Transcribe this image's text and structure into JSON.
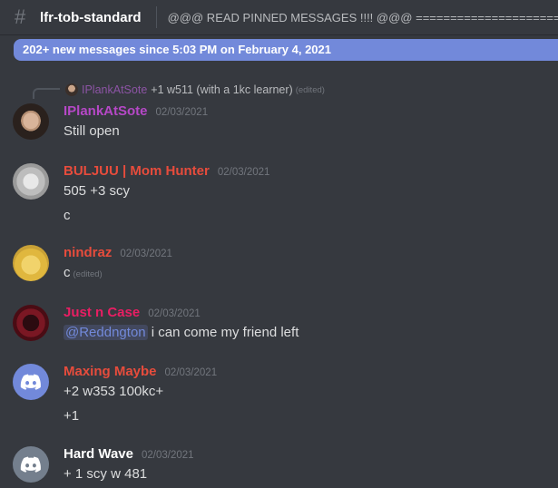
{
  "header": {
    "channel_name": "lfr-tob-standard",
    "topic": "@@@ READ PINNED MESSAGES !!!! @@@ =========================="
  },
  "new_messages_bar": "202+ new messages since 5:03 PM on February 4, 2021",
  "reply": {
    "author": "IPlankAtSote",
    "text": "+1 w511 (with a 1kc learner)",
    "edited": "(edited)"
  },
  "messages": [
    {
      "author": "IPlankAtSote",
      "color": "#b548c6",
      "timestamp": "02/03/2021",
      "lines": [
        "Still open"
      ]
    },
    {
      "author": "BULJUU | Mom Hunter",
      "color": "#e74c3c",
      "timestamp": "02/03/2021",
      "lines": [
        "505 +3 scy",
        "c"
      ]
    },
    {
      "author": "nindraz",
      "color": "#e74c3c",
      "timestamp": "02/03/2021",
      "lines": [
        "c"
      ],
      "edited": "(edited)"
    },
    {
      "author": "Just n Case",
      "color": "#e91e63",
      "timestamp": "02/03/2021",
      "mention": "@Reddngton",
      "lines": [
        "i can come my friend left"
      ]
    },
    {
      "author": "Maxing Maybe",
      "color": "#e74c3c",
      "timestamp": "02/03/2021",
      "lines": [
        "+2 w353 100kc+",
        "+1"
      ]
    },
    {
      "author": "Hard Wave",
      "color": "#ffffff",
      "timestamp": "02/03/2021",
      "lines": [
        "+ 1 scy w 481"
      ]
    }
  ]
}
